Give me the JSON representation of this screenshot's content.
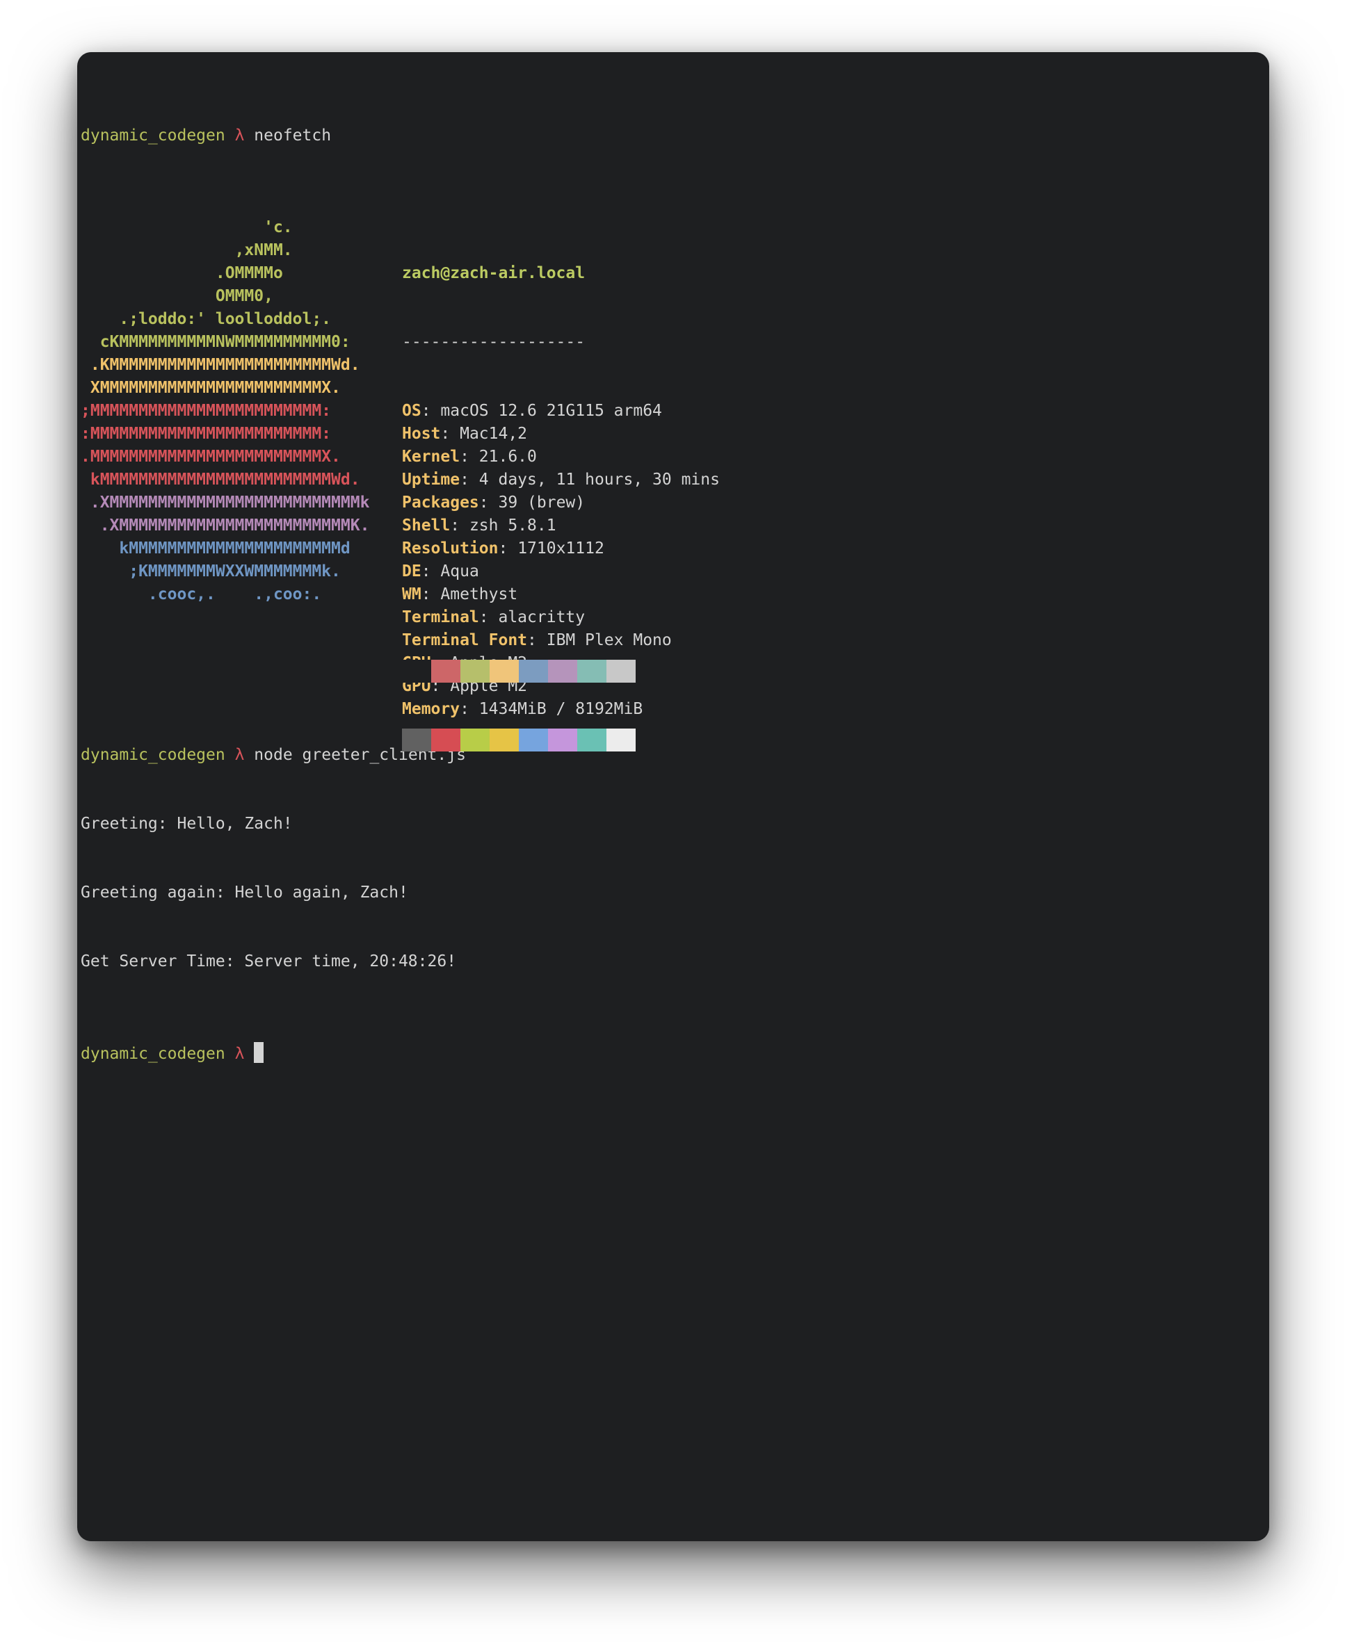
{
  "prompt": {
    "dir": "dynamic_codegen",
    "symbol": "λ"
  },
  "commands": {
    "first": "neofetch",
    "second": "node greeter_client.js"
  },
  "neofetch": {
    "logo_lines": [
      {
        "text": "                   'c.",
        "color": "#b9c25e"
      },
      {
        "text": "                ,xNMM.",
        "color": "#b9c25e"
      },
      {
        "text": "              .OMMMMo",
        "color": "#b9c25e"
      },
      {
        "text": "              OMMM0,",
        "color": "#b9c25e"
      },
      {
        "text": "    .;loddo:' loolloddol;.",
        "color": "#b9c25e"
      },
      {
        "text": "  cKMMMMMMMMMMNWMMMMMMMMMM0:",
        "color": "#b9c25e"
      },
      {
        "text": " .KMMMMMMMMMMMMMMMMMMMMMMMWd.",
        "color": "#f0c26a"
      },
      {
        "text": " XMMMMMMMMMMMMMMMMMMMMMMMX.",
        "color": "#f0c26a"
      },
      {
        "text": ";MMMMMMMMMMMMMMMMMMMMMMMM:",
        "color": "#d8545a"
      },
      {
        "text": ":MMMMMMMMMMMMMMMMMMMMMMMM:",
        "color": "#d8545a"
      },
      {
        "text": ".MMMMMMMMMMMMMMMMMMMMMMMMX.",
        "color": "#d8545a"
      },
      {
        "text": " kMMMMMMMMMMMMMMMMMMMMMMMMWd.",
        "color": "#d8545a"
      },
      {
        "text": " .XMMMMMMMMMMMMMMMMMMMMMMMMMMk",
        "color": "#b58ab8"
      },
      {
        "text": "  .XMMMMMMMMMMMMMMMMMMMMMMMMK.",
        "color": "#b58ab8"
      },
      {
        "text": "    kMMMMMMMMMMMMMMMMMMMMMMd",
        "color": "#6f96c4"
      },
      {
        "text": "     ;KMMMMMMMWXXWMMMMMMMk.",
        "color": "#6f96c4"
      },
      {
        "text": "       .cooc,.    .,coo:.",
        "color": "#6f96c4"
      }
    ],
    "userhost": "zach@zach-air.local",
    "separator": "-------------------",
    "fields": [
      {
        "key": "OS",
        "value": "macOS 12.6 21G115 arm64"
      },
      {
        "key": "Host",
        "value": "Mac14,2"
      },
      {
        "key": "Kernel",
        "value": "21.6.0"
      },
      {
        "key": "Uptime",
        "value": "4 days, 11 hours, 30 mins"
      },
      {
        "key": "Packages",
        "value": "39 (brew)"
      },
      {
        "key": "Shell",
        "value": "zsh 5.8.1"
      },
      {
        "key": "Resolution",
        "value": "1710x1112"
      },
      {
        "key": "DE",
        "value": "Aqua"
      },
      {
        "key": "WM",
        "value": "Amethyst"
      },
      {
        "key": "Terminal",
        "value": "alacritty"
      },
      {
        "key": "Terminal Font",
        "value": "IBM Plex Mono"
      },
      {
        "key": "CPU",
        "value": "Apple M2"
      },
      {
        "key": "GPU",
        "value": "Apple M2"
      },
      {
        "key": "Memory",
        "value": "1434MiB / 8192MiB"
      }
    ],
    "palette_top": [
      "#1e1f21",
      "#cd6668",
      "#b6bf6b",
      "#f0c57a",
      "#7c9cc0",
      "#b594bb",
      "#85bdb4",
      "#c8c8c8"
    ],
    "palette_bottom": [
      "#616161",
      "#d64d53",
      "#b8cd48",
      "#e6c446",
      "#76a4de",
      "#c596dc",
      "#6ac1b4",
      "#ececec"
    ]
  },
  "output_lines": [
    "Greeting: Hello, Zach!",
    "Greeting again: Hello again, Zach!",
    "Get Server Time: Server time, 20:48:26!"
  ],
  "colors": {
    "background": "#1e1f21",
    "foreground": "#d4d4d4",
    "prompt_dir": "#b9c25e",
    "prompt_symbol": "#d8545a",
    "key": "#f0c26a"
  }
}
